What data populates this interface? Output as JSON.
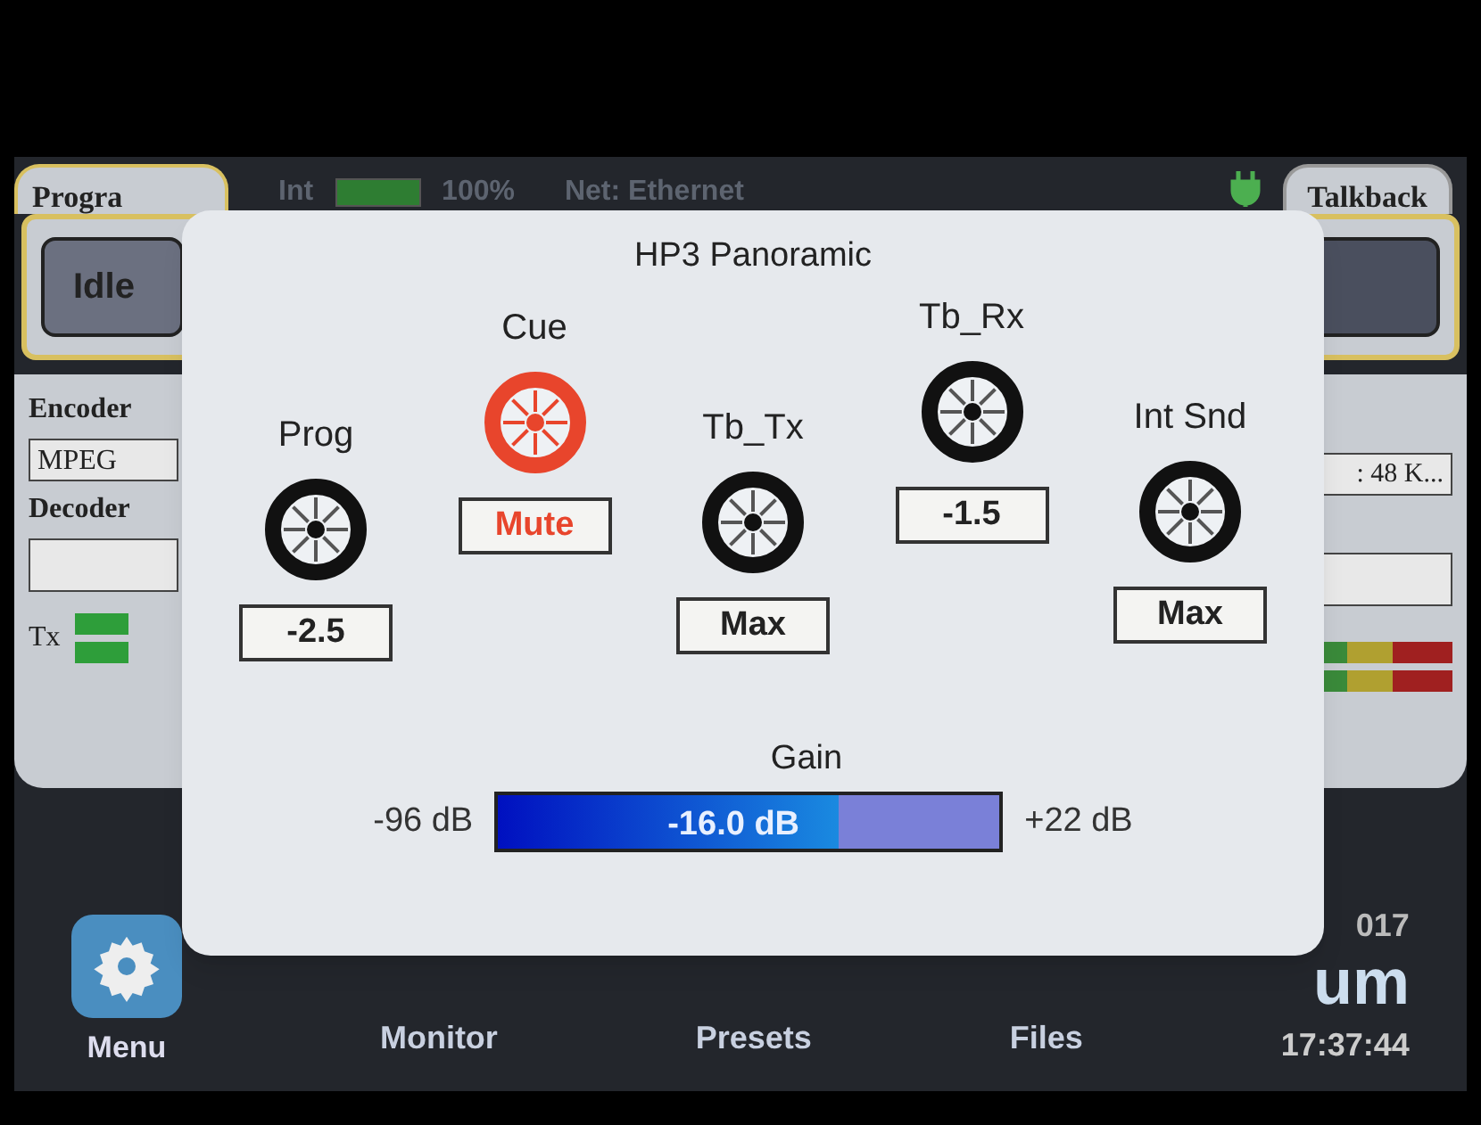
{
  "status_bar": {
    "program_tab": "Progra",
    "int_label": "Int",
    "int_meter": {
      "level": 1.0
    },
    "int_reading": "100%",
    "network": "Net: Ethernet",
    "talkback_tab": "Talkback"
  },
  "program_panel": {
    "status_button": "Idle"
  },
  "codec_panel": {
    "encoder_label": "Encoder",
    "encoder_value": "MPEG",
    "encoder_detail": ": 48 K...",
    "decoder_label": "Decoder",
    "tx_label": "Tx"
  },
  "dialog": {
    "title": "HP3 Panoramic",
    "knobs": [
      {
        "label": "Prog",
        "value": "-2.5",
        "muted": false
      },
      {
        "label": "Cue",
        "value": "Mute",
        "muted": true
      },
      {
        "label": "Tb_Tx",
        "value": "Max",
        "muted": false
      },
      {
        "label": "Tb_Rx",
        "value": "-1.5",
        "muted": false
      },
      {
        "label": "Int Snd",
        "value": "Max",
        "muted": false
      }
    ],
    "gain": {
      "label": "Gain",
      "min": "-96 dB",
      "max": "+22 dB",
      "reading": "-16.0 dB",
      "level": 0.68
    }
  },
  "bottom_bar": {
    "nav": [
      "Menu",
      "Monitor",
      "Presets",
      "Files"
    ],
    "date": "017",
    "brand": "um",
    "time": "17:37:44"
  }
}
